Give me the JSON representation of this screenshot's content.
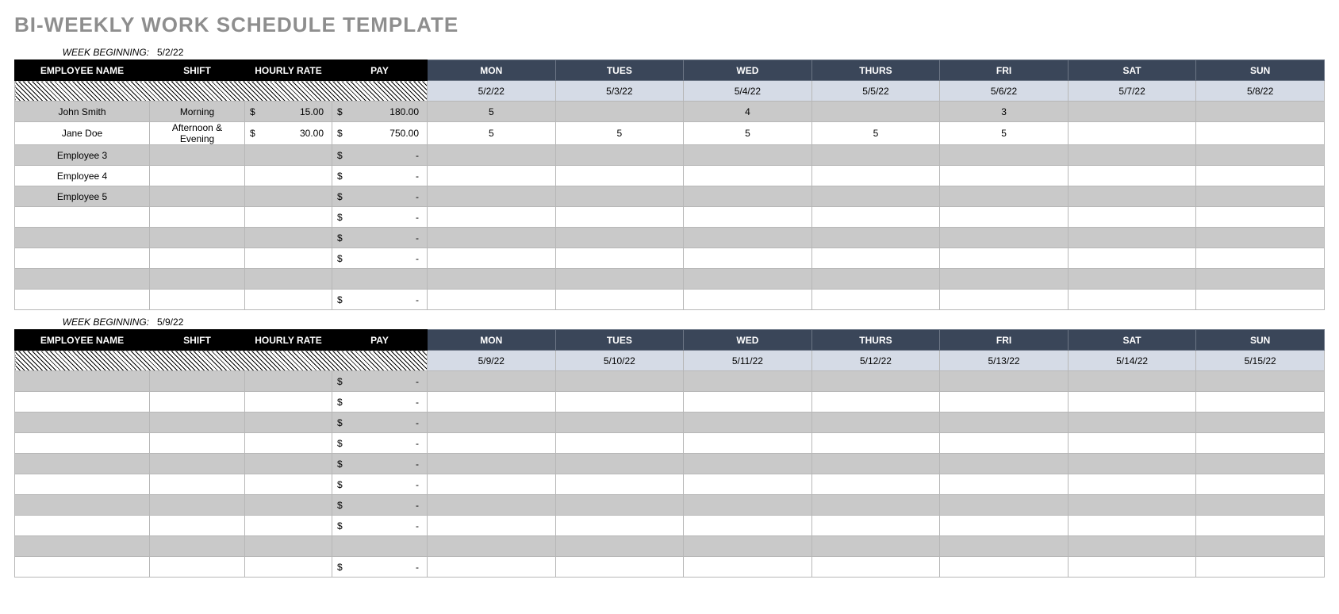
{
  "title": "BI-WEEKLY WORK SCHEDULE TEMPLATE",
  "week_begin_label": "WEEK BEGINNING:",
  "currency_symbol": "$",
  "dash": "-",
  "headers": {
    "emp": "EMPLOYEE NAME",
    "shift": "SHIFT",
    "rate": "HOURLY RATE",
    "pay": "PAY",
    "days": [
      "MON",
      "TUES",
      "WED",
      "THURS",
      "FRI",
      "SAT",
      "SUN"
    ]
  },
  "weeks": [
    {
      "begin_date": "5/2/22",
      "dates": [
        "5/2/22",
        "5/3/22",
        "5/4/22",
        "5/5/22",
        "5/6/22",
        "5/7/22",
        "5/8/22"
      ],
      "rows": [
        {
          "emp": "John Smith",
          "shift": "Morning",
          "rate": "15.00",
          "pay": "180.00",
          "days": [
            "5",
            "",
            "4",
            "",
            "3",
            "",
            ""
          ]
        },
        {
          "emp": "Jane Doe",
          "shift": "Afternoon & Evening",
          "rate": "30.00",
          "pay": "750.00",
          "days": [
            "5",
            "5",
            "5",
            "5",
            "5",
            "",
            ""
          ]
        },
        {
          "emp": "Employee 3",
          "shift": "",
          "rate": "",
          "pay": "-",
          "days": [
            "",
            "",
            "",
            "",
            "",
            "",
            ""
          ]
        },
        {
          "emp": "Employee 4",
          "shift": "",
          "rate": "",
          "pay": "-",
          "days": [
            "",
            "",
            "",
            "",
            "",
            "",
            ""
          ]
        },
        {
          "emp": "Employee 5",
          "shift": "",
          "rate": "",
          "pay": "-",
          "days": [
            "",
            "",
            "",
            "",
            "",
            "",
            ""
          ]
        },
        {
          "emp": "",
          "shift": "",
          "rate": "",
          "pay": "-",
          "days": [
            "",
            "",
            "",
            "",
            "",
            "",
            ""
          ]
        },
        {
          "emp": "",
          "shift": "",
          "rate": "",
          "pay": "-",
          "days": [
            "",
            "",
            "",
            "",
            "",
            "",
            ""
          ]
        },
        {
          "emp": "",
          "shift": "",
          "rate": "",
          "pay": "-",
          "days": [
            "",
            "",
            "",
            "",
            "",
            "",
            ""
          ]
        },
        {
          "emp": "",
          "shift": "",
          "rate": "",
          "pay": "",
          "days": [
            "",
            "",
            "",
            "",
            "",
            "",
            ""
          ]
        },
        {
          "emp": "",
          "shift": "",
          "rate": "",
          "pay": "-",
          "days": [
            "",
            "",
            "",
            "",
            "",
            "",
            ""
          ]
        }
      ]
    },
    {
      "begin_date": "5/9/22",
      "dates": [
        "5/9/22",
        "5/10/22",
        "5/11/22",
        "5/12/22",
        "5/13/22",
        "5/14/22",
        "5/15/22"
      ],
      "rows": [
        {
          "emp": "",
          "shift": "",
          "rate": "",
          "pay": "-",
          "days": [
            "",
            "",
            "",
            "",
            "",
            "",
            ""
          ]
        },
        {
          "emp": "",
          "shift": "",
          "rate": "",
          "pay": "-",
          "days": [
            "",
            "",
            "",
            "",
            "",
            "",
            ""
          ]
        },
        {
          "emp": "",
          "shift": "",
          "rate": "",
          "pay": "-",
          "days": [
            "",
            "",
            "",
            "",
            "",
            "",
            ""
          ]
        },
        {
          "emp": "",
          "shift": "",
          "rate": "",
          "pay": "-",
          "days": [
            "",
            "",
            "",
            "",
            "",
            "",
            ""
          ]
        },
        {
          "emp": "",
          "shift": "",
          "rate": "",
          "pay": "-",
          "days": [
            "",
            "",
            "",
            "",
            "",
            "",
            ""
          ]
        },
        {
          "emp": "",
          "shift": "",
          "rate": "",
          "pay": "-",
          "days": [
            "",
            "",
            "",
            "",
            "",
            "",
            ""
          ]
        },
        {
          "emp": "",
          "shift": "",
          "rate": "",
          "pay": "-",
          "days": [
            "",
            "",
            "",
            "",
            "",
            "",
            ""
          ]
        },
        {
          "emp": "",
          "shift": "",
          "rate": "",
          "pay": "-",
          "days": [
            "",
            "",
            "",
            "",
            "",
            "",
            ""
          ]
        },
        {
          "emp": "",
          "shift": "",
          "rate": "",
          "pay": "",
          "days": [
            "",
            "",
            "",
            "",
            "",
            "",
            ""
          ]
        },
        {
          "emp": "",
          "shift": "",
          "rate": "",
          "pay": "-",
          "days": [
            "",
            "",
            "",
            "",
            "",
            "",
            ""
          ]
        }
      ]
    }
  ]
}
